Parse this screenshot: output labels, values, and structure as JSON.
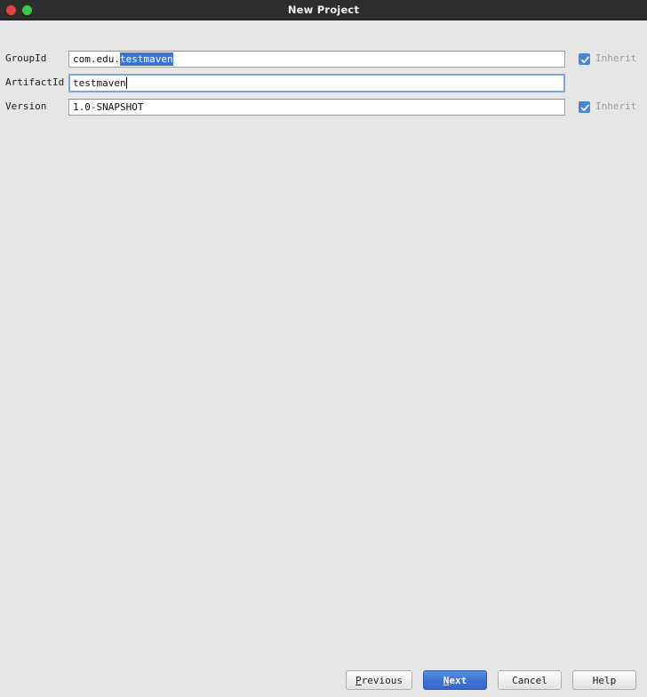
{
  "window": {
    "title": "New Project",
    "traffic_lights": [
      {
        "name": "close",
        "color": "#e0443e"
      },
      {
        "name": "zoom",
        "color": "#3bc94a"
      }
    ]
  },
  "form": {
    "rows": [
      {
        "label": "GroupId",
        "value_prefix": "com.edu.",
        "value_selected": "testmaven",
        "full_value": "com.edu.testmaven",
        "focused": false,
        "inherit": {
          "label": "Inherit",
          "checked": true,
          "enabled": false
        }
      },
      {
        "label": "ArtifactId",
        "value": "testmaven",
        "focused": true,
        "inherit": null
      },
      {
        "label": "Version",
        "value": "1.0-SNAPSHOT",
        "focused": false,
        "inherit": {
          "label": "Inherit",
          "checked": true,
          "enabled": false
        }
      }
    ]
  },
  "buttons": {
    "previous": {
      "label_before": "",
      "mnemonic": "P",
      "label_after": "revious"
    },
    "next": {
      "label_before": "",
      "mnemonic": "N",
      "label_after": "ext"
    },
    "cancel": {
      "label": "Cancel"
    },
    "help": {
      "label": "Help"
    }
  },
  "colors": {
    "titlebar_bg": "#2d2d2d",
    "dialog_bg": "#e6e6e6",
    "selection_blue": "#3875d7",
    "default_button_blue": "#3e74d4",
    "checkbox_blue": "#4a86d8",
    "focus_border": "#7ba7d7",
    "disabled_text": "#9b9b9b"
  }
}
